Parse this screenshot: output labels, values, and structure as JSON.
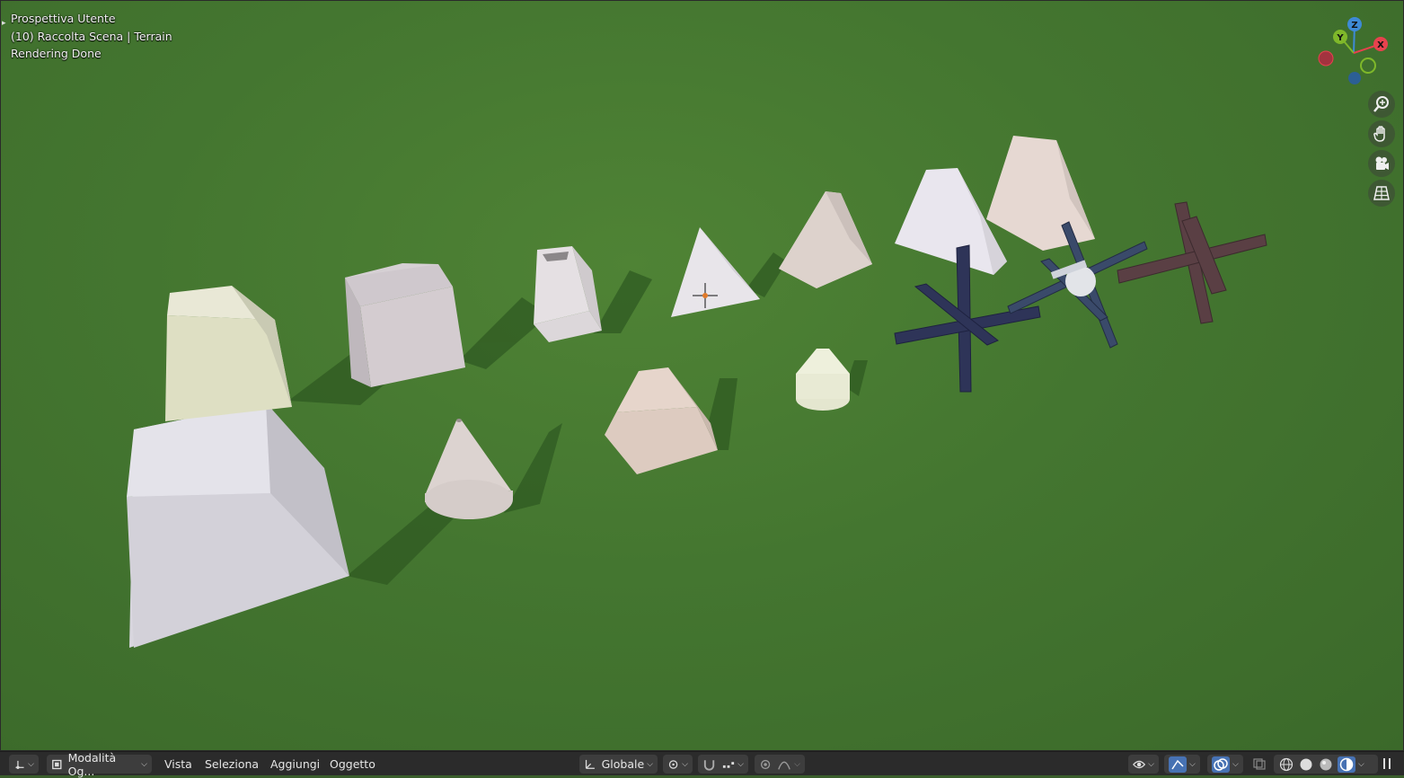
{
  "viewport": {
    "perspective": "Prospettiva Utente",
    "collection": "(10) Raccolta Scena | Terrain",
    "status": "Rendering Done",
    "background_color": "#447630"
  },
  "gizmo": {
    "z": "Z",
    "y": "Y",
    "x": "X",
    "x_color": "#e8424e",
    "y_color": "#7fb82a",
    "z_color": "#3e8ad6"
  },
  "nav_buttons": [
    "zoom-icon",
    "hand-pan-icon",
    "camera-icon",
    "grid-ortho-icon"
  ],
  "toolbar": {
    "mode_label": "Modalità Og...",
    "menus": [
      "Vista",
      "Seleziona",
      "Aggiungi",
      "Oggetto"
    ],
    "transform_orientation": "Globale"
  }
}
